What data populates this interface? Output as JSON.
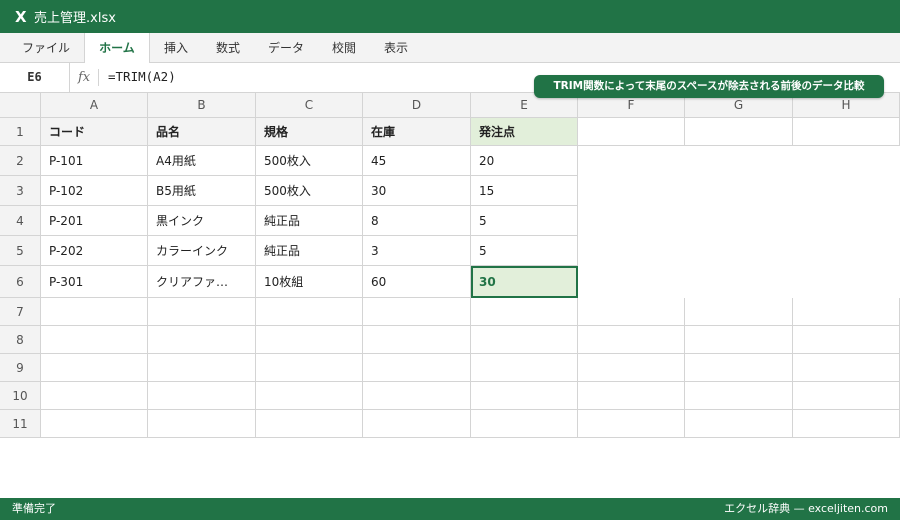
{
  "titlebar": {
    "app_icon_letter": "X",
    "filename": "売上管理.xlsx"
  },
  "ribbon": {
    "tabs": [
      "ファイル",
      "ホーム",
      "挿入",
      "数式",
      "データ",
      "校閲",
      "表示"
    ],
    "active_tab": "ホーム"
  },
  "formula_bar": {
    "name_box": "E6",
    "fx_label": "fx",
    "formula": "=TRIM(A2)"
  },
  "callout": "TRIM関数によって末尾のスペースが除去される前後のデータ比較",
  "sheet": {
    "columns": [
      "A",
      "B",
      "C",
      "D",
      "E",
      "F",
      "G",
      "H"
    ],
    "rows": [
      "1",
      "2",
      "3",
      "4",
      "5",
      "6",
      "7",
      "8",
      "9",
      "10",
      "11"
    ],
    "header": [
      "コード",
      "品名",
      "規格",
      "在庫",
      "発注点"
    ],
    "data": [
      [
        "P-101",
        "A4用紙",
        "500枚入",
        "45",
        "20"
      ],
      [
        "P-102",
        "B5用紙",
        "500枚入",
        "30",
        "15"
      ],
      [
        "P-201",
        "黒インク",
        "純正品",
        "8",
        "5"
      ],
      [
        "P-202",
        "カラーインク",
        "純正品",
        "3",
        "5"
      ],
      [
        "P-301",
        "クリアファ…",
        "10枚組",
        "60",
        "30"
      ]
    ],
    "selected_cell": "E6"
  },
  "statusbar": {
    "left": "準備完了",
    "right": "エクセル辞典 — exceljiten.com"
  },
  "colors": {
    "accent": "#217346",
    "highlight": "#e2efda",
    "header_bg": "#f3f3f3",
    "gridline": "#d4d4d4"
  }
}
